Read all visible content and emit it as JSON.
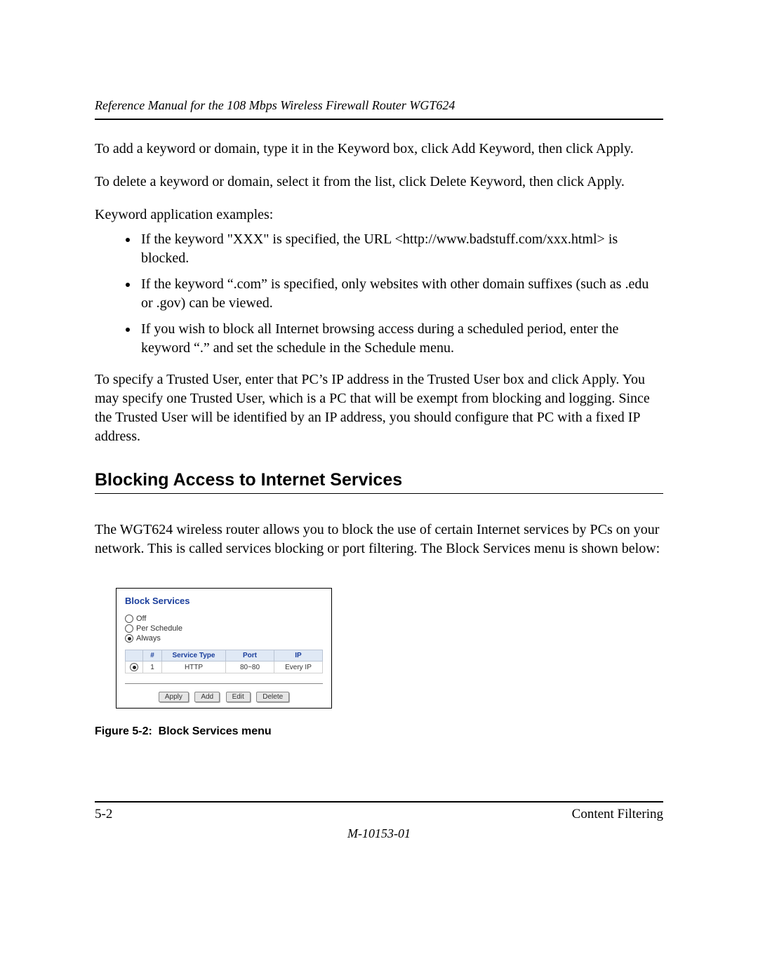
{
  "header": {
    "running_title": "Reference Manual for the 108 Mbps Wireless Firewall Router WGT624"
  },
  "body": {
    "p1": "To add a keyword or domain, type it in the Keyword box, click Add Keyword, then click Apply.",
    "p2": "To delete a keyword or domain, select it from the list, click Delete Keyword, then click Apply.",
    "p3": "Keyword application examples:",
    "bullets": [
      "If the keyword \"XXX\" is specified, the URL <http://www.badstuff.com/xxx.html> is blocked.",
      "If the keyword “.com” is specified, only websites with other domain suffixes (such as .edu or .gov) can be viewed.",
      "If you wish to block all Internet browsing access during a scheduled period, enter the keyword “.” and set the schedule in the Schedule menu."
    ],
    "p4": "To specify a Trusted User, enter that PC’s IP address in the Trusted User box and click Apply. You may specify one Trusted User, which is a PC that will be exempt from blocking and logging. Since the Trusted User will be identified by an IP address, you should configure that PC with a fixed IP address.",
    "section_heading": "Blocking Access to Internet Services",
    "p5": "The WGT624 wireless router allows you to block the use of certain Internet services by PCs on your network. This is called services blocking or port filtering. The Block Services menu is shown below:"
  },
  "figure": {
    "title": "Block Services",
    "radios": {
      "off": "Off",
      "per_schedule": "Per Schedule",
      "always": "Always"
    },
    "table": {
      "headers": {
        "sel": "",
        "num": "#",
        "svc": "Service Type",
        "port": "Port",
        "ip": "IP"
      },
      "row": {
        "num": "1",
        "svc": "HTTP",
        "port": "80~80",
        "ip": "Every IP"
      }
    },
    "buttons": {
      "apply": "Apply",
      "add": "Add",
      "edit": "Edit",
      "delete": "Delete"
    },
    "caption": "Figure 5-2:  Block Services menu"
  },
  "footer": {
    "page": "5-2",
    "section": "Content Filtering",
    "docno": "M-10153-01"
  }
}
